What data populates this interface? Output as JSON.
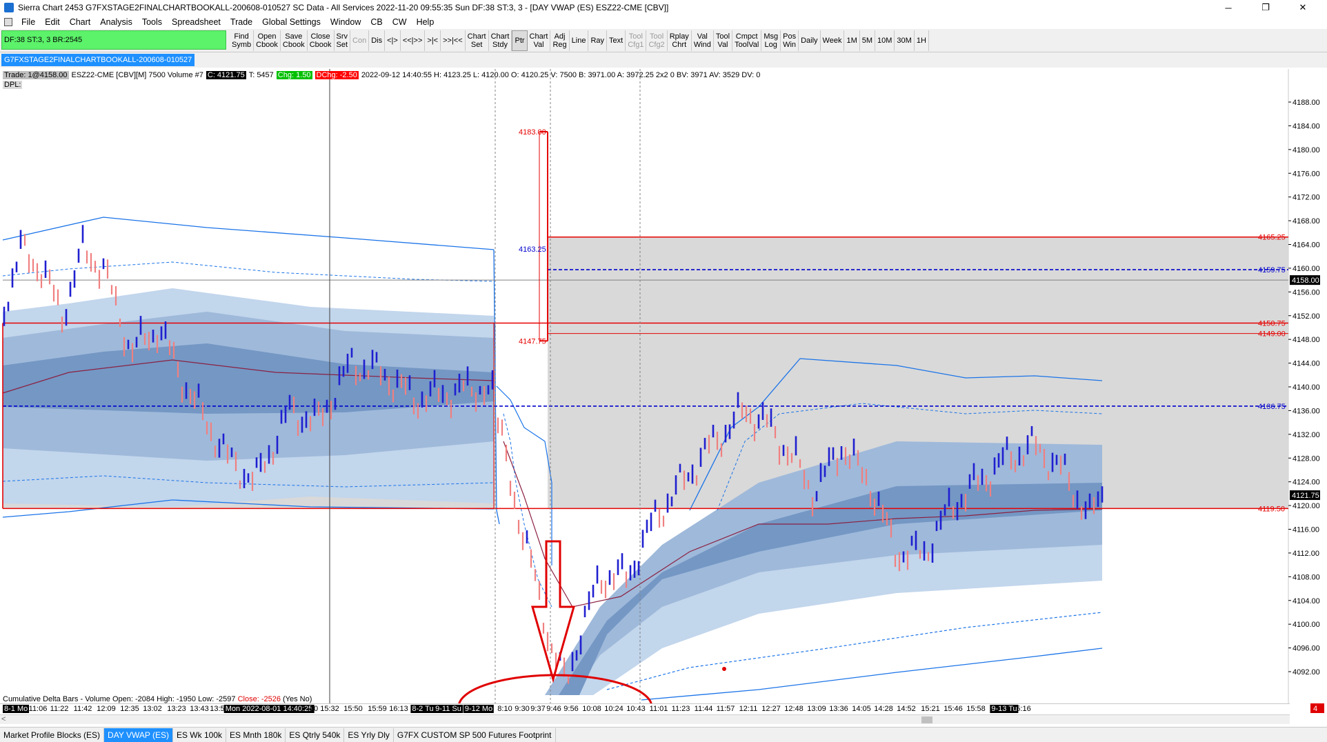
{
  "window": {
    "title": "Sierra Chart 2453 G7FXSTAGE2FINALCHARTBOOKALL-200608-010527  SC Data - All Services 2022-11-20  09:55:35 Sun  DF:38  ST:3, 3 - [DAY VWAP (ES) ESZ22-CME [CBV]]",
    "controls": {
      "minimize": "─",
      "restore": "❐",
      "close": "✕"
    }
  },
  "menu": [
    "File",
    "Edit",
    "Chart",
    "Analysis",
    "Tools",
    "Spreadsheet",
    "Trade",
    "Global Settings",
    "Window",
    "CB",
    "CW",
    "Help"
  ],
  "toolbar": {
    "status": "DF:38  ST:3, 3   BR:2545",
    "buttons": [
      {
        "l1": "Find",
        "l2": "Symb"
      },
      {
        "l1": "Open",
        "l2": "Cbook"
      },
      {
        "l1": "Save",
        "l2": "Cbook"
      },
      {
        "l1": "Close",
        "l2": "Cbook"
      },
      {
        "l1": "Srv",
        "l2": "Set"
      },
      {
        "l1": "Con",
        "l2": "",
        "disabled": true
      },
      {
        "l1": "Dis",
        "l2": ""
      },
      {
        "l1": "<|>",
        "l2": ""
      },
      {
        "l1": "<<|>>",
        "l2": ""
      },
      {
        "l1": ">|<",
        "l2": ""
      },
      {
        "l1": ">>|<<",
        "l2": ""
      },
      {
        "l1": "Chart",
        "l2": "Set"
      },
      {
        "l1": "Chart",
        "l2": "Stdy"
      },
      {
        "l1": "Ptr",
        "l2": "",
        "active": true
      },
      {
        "l1": "Chart",
        "l2": "Val"
      },
      {
        "l1": "Adj",
        "l2": "Reg"
      },
      {
        "l1": "Line",
        "l2": ""
      },
      {
        "l1": "Ray",
        "l2": ""
      },
      {
        "l1": "Text",
        "l2": ""
      },
      {
        "l1": "Tool",
        "l2": "Cfg1",
        "disabled": true
      },
      {
        "l1": "Tool",
        "l2": "Cfg2",
        "disabled": true
      },
      {
        "l1": "Rplay",
        "l2": "Chrt"
      },
      {
        "l1": "Val",
        "l2": "Wind"
      },
      {
        "l1": "Tool",
        "l2": "Val"
      },
      {
        "l1": "Cmpct",
        "l2": "ToolVal"
      },
      {
        "l1": "Msg",
        "l2": "Log"
      },
      {
        "l1": "Pos",
        "l2": "Win"
      },
      {
        "l1": "Daily",
        "l2": ""
      },
      {
        "l1": "Week",
        "l2": ""
      },
      {
        "l1": "1M",
        "l2": ""
      },
      {
        "l1": "5M",
        "l2": ""
      },
      {
        "l1": "10M",
        "l2": ""
      },
      {
        "l1": "30M",
        "l2": ""
      },
      {
        "l1": "1H",
        "l2": ""
      }
    ]
  },
  "chart_tab": "G7FXSTAGE2FINALCHARTBOOKALL-200608-010527",
  "info": {
    "trade": "Trade: 1@4158.00",
    "symbol": "ESZ22-CME [CBV][M]  7500 Volume  #7",
    "close": "C: 4121.75",
    "t": "T: 5457",
    "chg": "Chg: 1.50",
    "dcchg": "DChg: -2.50",
    "rest": "2022-09-12  14:40:55 H: 4123.25 L: 4120.00 O: 4120.25 V: 7500 B: 3971.00 A: 3972.25 2x2 0 BV: 3971 AV: 3529 DV: 0",
    "dpl": "DPL:"
  },
  "subgraph": {
    "prefix": "Cumulative Delta Bars - Volume  Open: -2084  High: -1950  Low: -2597",
    "close": "Close: -2526",
    "suffix": "(Yes No)"
  },
  "price_axis": {
    "ticks": [
      "4188.00",
      "4184.00",
      "4180.00",
      "4176.00",
      "4172.00",
      "4168.00",
      "4164.00",
      "4160.00",
      "4156.00",
      "4152.00",
      "4148.00",
      "4144.00",
      "4140.00",
      "4136.00",
      "4132.00",
      "4128.00",
      "4124.00",
      "4120.00",
      "4116.00",
      "4112.00",
      "4108.00",
      "4104.00",
      "4100.00",
      "4096.00",
      "4092.00"
    ],
    "current_price": "4158.00",
    "last_price": "4121.75",
    "right_tag": "4"
  },
  "levels": {
    "l4165": "4165.25",
    "l4159": "4159.75",
    "l4150": "4150.75",
    "l4149": "4149.00",
    "l4136": "4136.75",
    "l4119": "4119.50",
    "l4183": "4183.00",
    "l4163": "4163.25",
    "l4147": "4147.75"
  },
  "time_axis": [
    {
      "t": "8-1 Mo",
      "boxed": true
    },
    {
      "t": "11:06"
    },
    {
      "t": "11:22"
    },
    {
      "t": "11:42"
    },
    {
      "t": "12:09"
    },
    {
      "t": "12:35"
    },
    {
      "t": "13:02"
    },
    {
      "t": "13:23"
    },
    {
      "t": "13:43"
    },
    {
      "t": "13:57"
    },
    {
      "t": "Mon 2022-08-01  14:40:25",
      "boxed": true
    },
    {
      "t": "10"
    },
    {
      "t": "15:32"
    },
    {
      "t": "15:50"
    },
    {
      "t": "15:59"
    },
    {
      "t": "16:13"
    },
    {
      "t": "8-2 Tu",
      "boxed": true
    },
    {
      "t": "9-11 Su",
      "boxed": true
    },
    {
      "t": "9-12 Mo",
      "boxed": true
    },
    {
      "t": "8:10"
    },
    {
      "t": "9:30"
    },
    {
      "t": "9:37"
    },
    {
      "t": "9:46"
    },
    {
      "t": "9:56"
    },
    {
      "t": "10:08"
    },
    {
      "t": "10:24"
    },
    {
      "t": "10:43"
    },
    {
      "t": "11:01"
    },
    {
      "t": "11:23"
    },
    {
      "t": "11:44"
    },
    {
      "t": "11:57"
    },
    {
      "t": "12:11"
    },
    {
      "t": "12:27"
    },
    {
      "t": "12:48"
    },
    {
      "t": "13:09"
    },
    {
      "t": "13:36"
    },
    {
      "t": "14:05"
    },
    {
      "t": "14:28"
    },
    {
      "t": "14:52"
    },
    {
      "t": "15:21"
    },
    {
      "t": "15:46"
    },
    {
      "t": "15:58"
    },
    {
      "t": "9-13 Tu",
      "boxed": true
    },
    {
      "t": "5:16"
    }
  ],
  "scrollbar": {
    "left_arrow": "<"
  },
  "tabs": [
    {
      "label": "Market Profile Blocks (ES)"
    },
    {
      "label": "DAY VWAP (ES)",
      "active": true
    },
    {
      "label": "ES Wk 100k"
    },
    {
      "label": "ES Mnth 180k"
    },
    {
      "label": "ES Qtrly 540k"
    },
    {
      "label": "ES Yrly Dly"
    },
    {
      "label": "G7FX CUSTOM SP 500 Futures Footprint"
    }
  ],
  "colors": {
    "up_bar": "#1f1fd0",
    "down_bar": "#f08080",
    "level_red": "#e60000",
    "dashed_blue": "#0000cc",
    "band_light": "#c2d6ec",
    "band_mid": "#9fb9da",
    "band_dark": "#7497c4",
    "zone_grey": "#d9d9d9",
    "annotation": "#e00000"
  }
}
